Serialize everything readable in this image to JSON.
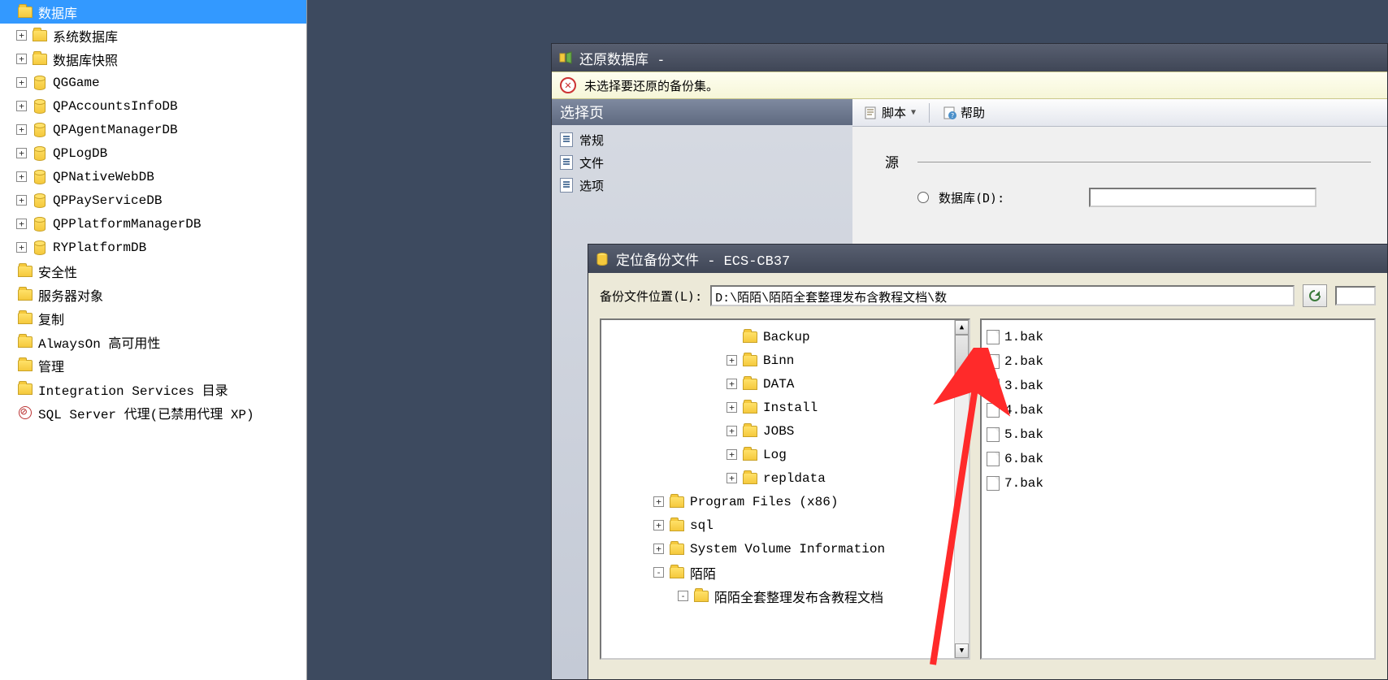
{
  "sidebar": {
    "items": [
      {
        "label": "数据库",
        "icon": "folder",
        "expander": "",
        "selected": true,
        "indent": 0
      },
      {
        "label": "系统数据库",
        "icon": "folder",
        "expander": "+",
        "indent": 1
      },
      {
        "label": "数据库快照",
        "icon": "folder",
        "expander": "+",
        "indent": 1
      },
      {
        "label": "QGGame",
        "icon": "db",
        "expander": "+",
        "indent": 1
      },
      {
        "label": "QPAccountsInfoDB",
        "icon": "db",
        "expander": "+",
        "indent": 1
      },
      {
        "label": "QPAgentManagerDB",
        "icon": "db",
        "expander": "+",
        "indent": 1
      },
      {
        "label": "QPLogDB",
        "icon": "db",
        "expander": "+",
        "indent": 1
      },
      {
        "label": "QPNativeWebDB",
        "icon": "db",
        "expander": "+",
        "indent": 1
      },
      {
        "label": "QPPayServiceDB",
        "icon": "db",
        "expander": "+",
        "indent": 1
      },
      {
        "label": "QPPlatformManagerDB",
        "icon": "db",
        "expander": "+",
        "indent": 1
      },
      {
        "label": "RYPlatformDB",
        "icon": "db",
        "expander": "+",
        "indent": 1
      },
      {
        "label": "安全性",
        "icon": "folder",
        "expander": "",
        "indent": 0
      },
      {
        "label": "服务器对象",
        "icon": "folder",
        "expander": "",
        "indent": 0
      },
      {
        "label": "复制",
        "icon": "folder",
        "expander": "",
        "indent": 0
      },
      {
        "label": "AlwaysOn 高可用性",
        "icon": "folder",
        "expander": "",
        "indent": 0
      },
      {
        "label": "管理",
        "icon": "folder",
        "expander": "",
        "indent": 0
      },
      {
        "label": "Integration Services 目录",
        "icon": "folder",
        "expander": "",
        "indent": 0
      },
      {
        "label": "SQL Server 代理(已禁用代理 XP)",
        "icon": "agent",
        "expander": "",
        "indent": 0
      }
    ]
  },
  "restoreDialog": {
    "title": "还原数据库 -",
    "errorMsg": "未选择要还原的备份集。",
    "selectPageHeader": "选择页",
    "pages": [
      {
        "label": "常规"
      },
      {
        "label": "文件"
      },
      {
        "label": "选项"
      }
    ],
    "toolbar": {
      "script": "脚本",
      "help": "帮助"
    },
    "form": {
      "sourceLabel": "源",
      "radioDbLabel": "数据库(D):"
    }
  },
  "locateDialog": {
    "title": "定位备份文件 - ECS-CB37",
    "pathLabel": "备份文件位置(L):",
    "pathValue": "D:\\陌陌\\陌陌全套整理发布含教程文档\\数",
    "folders": [
      {
        "label": "Backup",
        "expander": "",
        "indent": 5,
        "selected": false
      },
      {
        "label": "Binn",
        "expander": "+",
        "indent": 5
      },
      {
        "label": "DATA",
        "expander": "+",
        "indent": 5
      },
      {
        "label": "Install",
        "expander": "+",
        "indent": 5
      },
      {
        "label": "JOBS",
        "expander": "+",
        "indent": 5
      },
      {
        "label": "Log",
        "expander": "+",
        "indent": 5
      },
      {
        "label": "repldata",
        "expander": "+",
        "indent": 5
      },
      {
        "label": "Program Files (x86)",
        "expander": "+",
        "indent": 2
      },
      {
        "label": "sql",
        "expander": "+",
        "indent": 2
      },
      {
        "label": "System Volume Information",
        "expander": "+",
        "indent": 2
      },
      {
        "label": "陌陌",
        "expander": "-",
        "indent": 2
      },
      {
        "label": "陌陌全套整理发布含教程文档",
        "expander": "-",
        "indent": 3
      }
    ],
    "files": [
      {
        "name": "1.bak"
      },
      {
        "name": "2.bak"
      },
      {
        "name": "3.bak"
      },
      {
        "name": "4.bak"
      },
      {
        "name": "5.bak"
      },
      {
        "name": "6.bak"
      },
      {
        "name": "7.bak"
      }
    ]
  }
}
